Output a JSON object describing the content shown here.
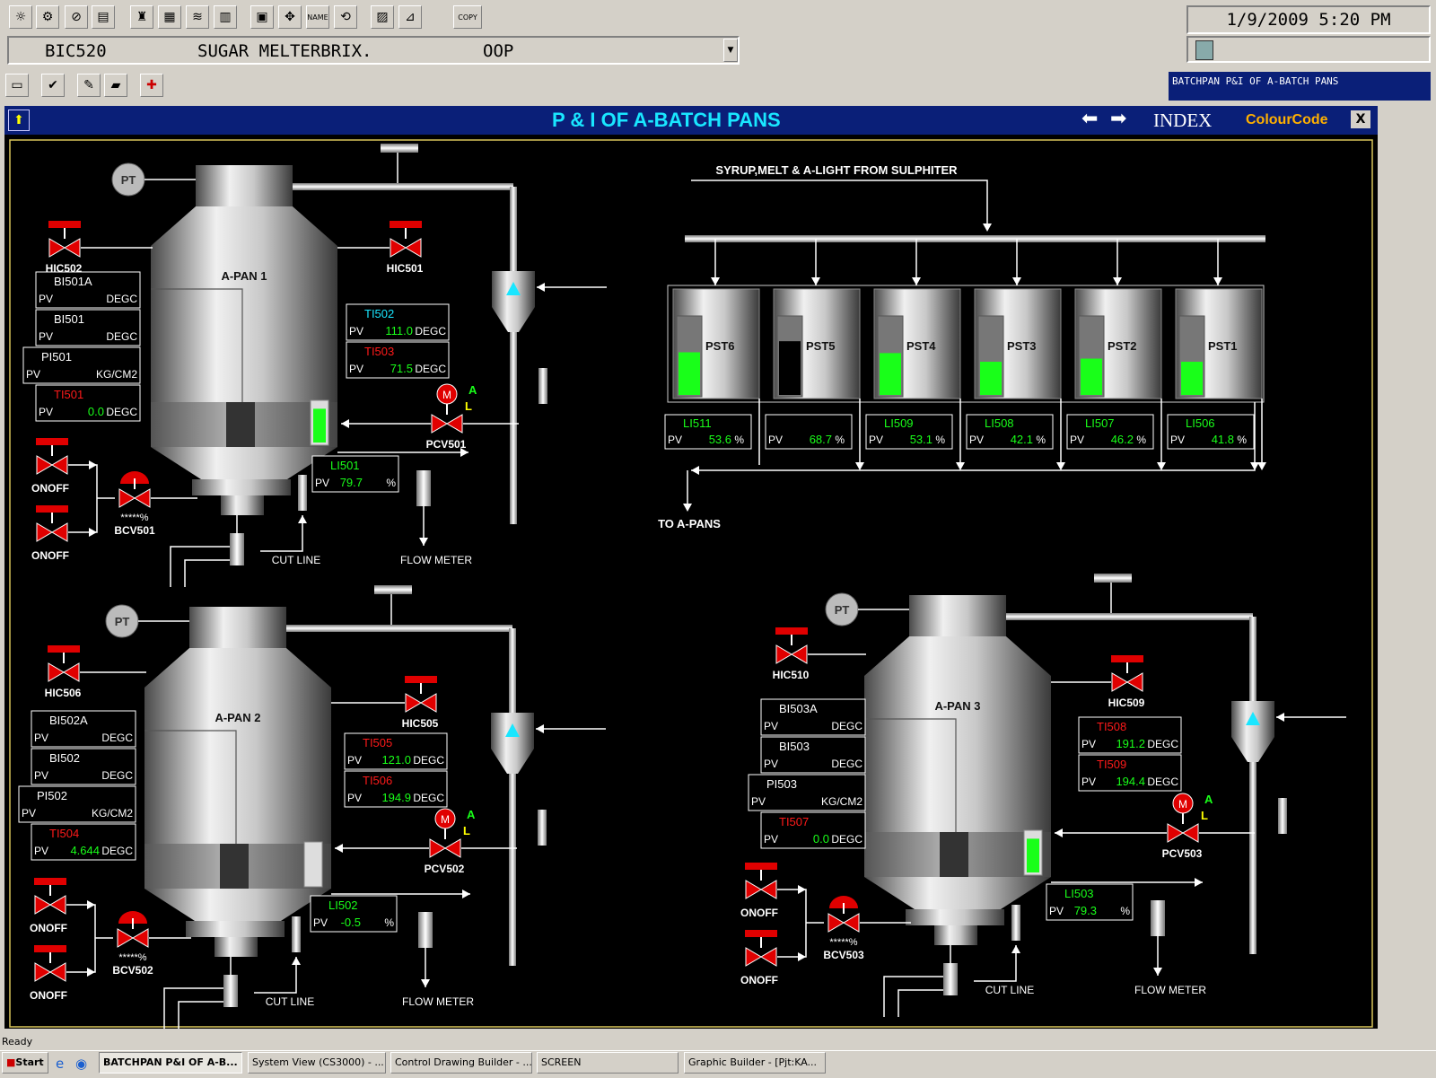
{
  "header": {
    "datetime": "1/9/2009 5:20 PM",
    "tag": "BIC520",
    "description": "SUGAR MELTERBRIX.",
    "mode": "OOP",
    "window_caption": "BATCHPAN P&I OF A-BATCH PANS",
    "copy_label": "COPY",
    "name_label": "NAME"
  },
  "screen": {
    "title": "P & I OF A-BATCH PANS",
    "index_label": "INDEX",
    "colour_code_label": "ColourCode",
    "close_label": "X",
    "feed_label": "SYRUP,MELT & A-LIGHT FROM SULPHITER",
    "to_pans_label": "TO A-PANS"
  },
  "common": {
    "pt": "PT",
    "pv": "PV",
    "degc": "DEGC",
    "kgcm2": "KG/CM2",
    "pct": "%",
    "onoff": "ONOFF",
    "cut_line": "CUT LINE",
    "flow_meter": "FLOW METER",
    "m": "M",
    "a": "A",
    "l": "L",
    "stars": "*****",
    "stars_pct": "*****%"
  },
  "tanks": [
    {
      "name": "PST6",
      "tag": "LI511",
      "value": "53.6",
      "level": 0.54
    },
    {
      "name": "PST5",
      "tag": "",
      "value": "68.7",
      "level": 0.68
    },
    {
      "name": "PST4",
      "tag": "LI509",
      "value": "53.1",
      "level": 0.53
    },
    {
      "name": "PST3",
      "tag": "LI508",
      "value": "42.1",
      "level": 0.42
    },
    {
      "name": "PST2",
      "tag": "LI507",
      "value": "46.2",
      "level": 0.46
    },
    {
      "name": "PST1",
      "tag": "LI506",
      "value": "41.8",
      "level": 0.42
    }
  ],
  "pan1": {
    "name": "A-PAN 1",
    "hic_left": "HIC502",
    "hic_right": "HIC501",
    "bia": "BI501A",
    "bi": "BI501",
    "pi": "PI501",
    "tl": {
      "tag": "TI501",
      "value": "0.0"
    },
    "t1": {
      "tag": "TI502",
      "value": "111.0"
    },
    "t2": {
      "tag": "TI503",
      "value": "71.5"
    },
    "pcv": "PCV501",
    "bcv": "BCV501",
    "li": {
      "tag": "LI501",
      "value": "79.7",
      "level": 0.8
    }
  },
  "pan2": {
    "name": "A-PAN 2",
    "hic_left": "HIC506",
    "hic_right": "HIC505",
    "bia": "BI502A",
    "bi": "BI502",
    "pi": "PI502",
    "tl": {
      "tag": "TI504",
      "value": "4.644"
    },
    "t1": {
      "tag": "TI505",
      "value": "121.0"
    },
    "t2": {
      "tag": "TI506",
      "value": "194.9"
    },
    "pcv": "PCV502",
    "bcv": "BCV502",
    "li": {
      "tag": "LI502",
      "value": "-0.5",
      "level": 0.0
    }
  },
  "pan3": {
    "name": "A-PAN 3",
    "hic_left": "HIC510",
    "hic_right": "HIC509",
    "bia": "BI503A",
    "bi": "BI503",
    "pi": "PI503",
    "tl": {
      "tag": "TI507",
      "value": "0.0"
    },
    "t1": {
      "tag": "TI508",
      "value": "191.2"
    },
    "t2": {
      "tag": "TI509",
      "value": "194.4"
    },
    "pcv": "PCV503",
    "bcv": "BCV503",
    "li": {
      "tag": "LI503",
      "value": "79.3",
      "level": 0.8
    }
  },
  "status": {
    "text": "Ready"
  },
  "taskbar": {
    "start": "Start",
    "items": [
      "BATCHPAN P&I OF A-B...",
      "System View (CS3000) - ...",
      "Control Drawing Builder - ...",
      "SCREEN",
      "Graphic Builder - [Pjt:KA..."
    ]
  },
  "colors": {
    "green": "#19ff19",
    "red": "#ff1a1a",
    "cyan": "#19e6ff",
    "title_bg": "#0a1f78",
    "valve_red": "#e00000"
  }
}
